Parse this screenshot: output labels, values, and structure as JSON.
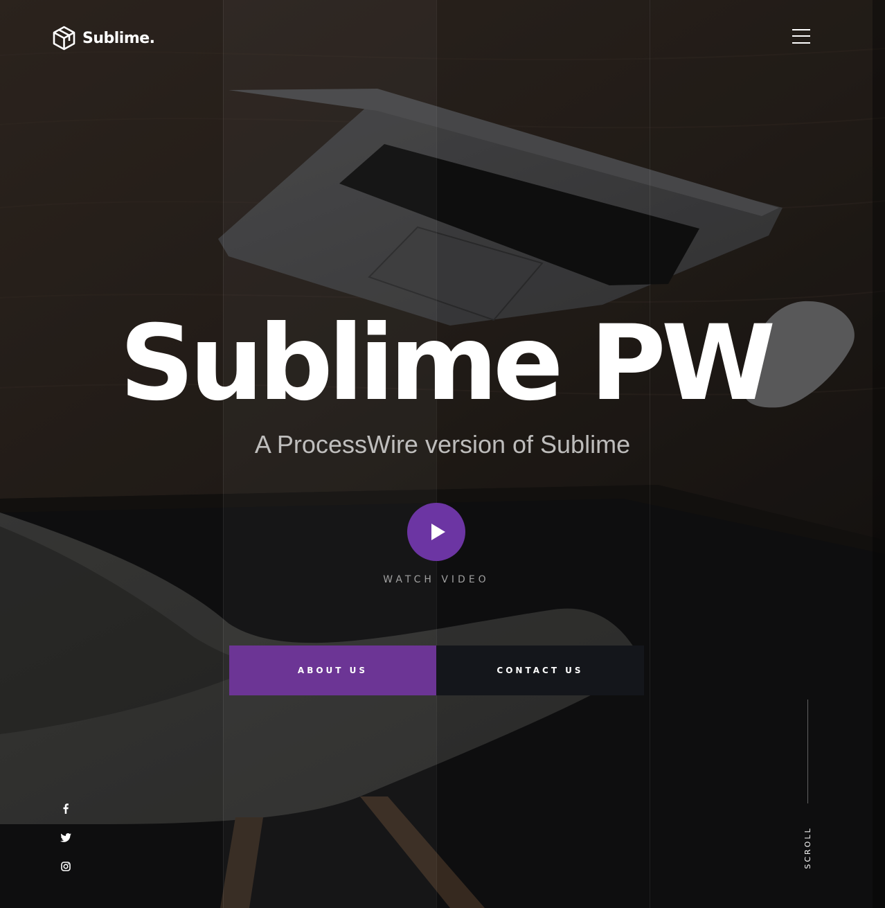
{
  "brand": {
    "logo_icon": "cube-outline-icon",
    "name": "Sublime."
  },
  "header": {
    "menu_icon": "hamburger-menu-icon"
  },
  "hero": {
    "title": "Sublime PW",
    "subtitle": "A ProcessWire version of Sublime",
    "play_icon": "play-icon",
    "watch_label": "WATCH VIDEO"
  },
  "actions": {
    "about_label": "ABOUT US",
    "contact_label": "CONTACT US"
  },
  "social": [
    {
      "icon": "facebook-icon"
    },
    {
      "icon": "twitter-icon"
    },
    {
      "icon": "instagram-icon"
    }
  ],
  "scroll": {
    "label": "SCROLL"
  },
  "colors": {
    "accent": "#6c3595",
    "play_button": "#6c35a3",
    "dark_button": "#14161b",
    "text": "#ffffff"
  }
}
